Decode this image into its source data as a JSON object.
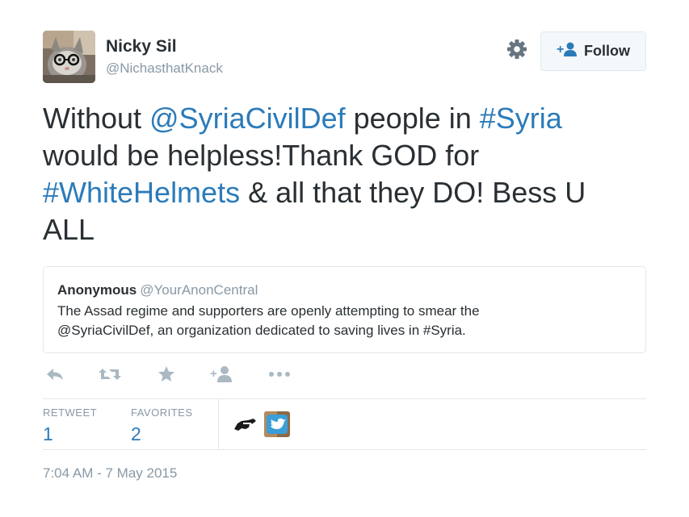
{
  "user": {
    "display_name": "Nicky Sil",
    "handle": "@NichasthatKnack"
  },
  "follow": {
    "label": "Follow"
  },
  "tweet": {
    "parts": [
      {
        "type": "text",
        "value": "Without "
      },
      {
        "type": "mention",
        "value": "@SyriaCivilDef"
      },
      {
        "type": "text",
        "value": " people in "
      },
      {
        "type": "hashtag",
        "value": "#Syria"
      },
      {
        "type": "text",
        "value": " would be helpless!Thank GOD for "
      },
      {
        "type": "hashtag",
        "value": "#WhiteHelmets"
      },
      {
        "type": "text",
        "value": " & all that they DO! Bess U ALL"
      }
    ]
  },
  "quote": {
    "name": "Anonymous",
    "handle": "@YourAnonCentral",
    "text_line1": "The Assad regime and supporters are openly attempting to smear the",
    "text_line2": "@SyriaCivilDef, an organization dedicated to saving lives in #Syria."
  },
  "actions": [
    "reply-icon",
    "retweet-icon",
    "favorite-icon",
    "follow-icon",
    "more-icon"
  ],
  "stats": {
    "retweet_label": "RETWEET",
    "retweet_count": "1",
    "favorites_label": "FAVORITES",
    "favorites_count": "2"
  },
  "timestamp": "7:04 AM - 7 May 2015",
  "colors": {
    "link": "#2b7bb9",
    "muted": "#8899a6",
    "text": "#292f33",
    "border": "#e1e8ed",
    "icon": "#aab8c2"
  }
}
